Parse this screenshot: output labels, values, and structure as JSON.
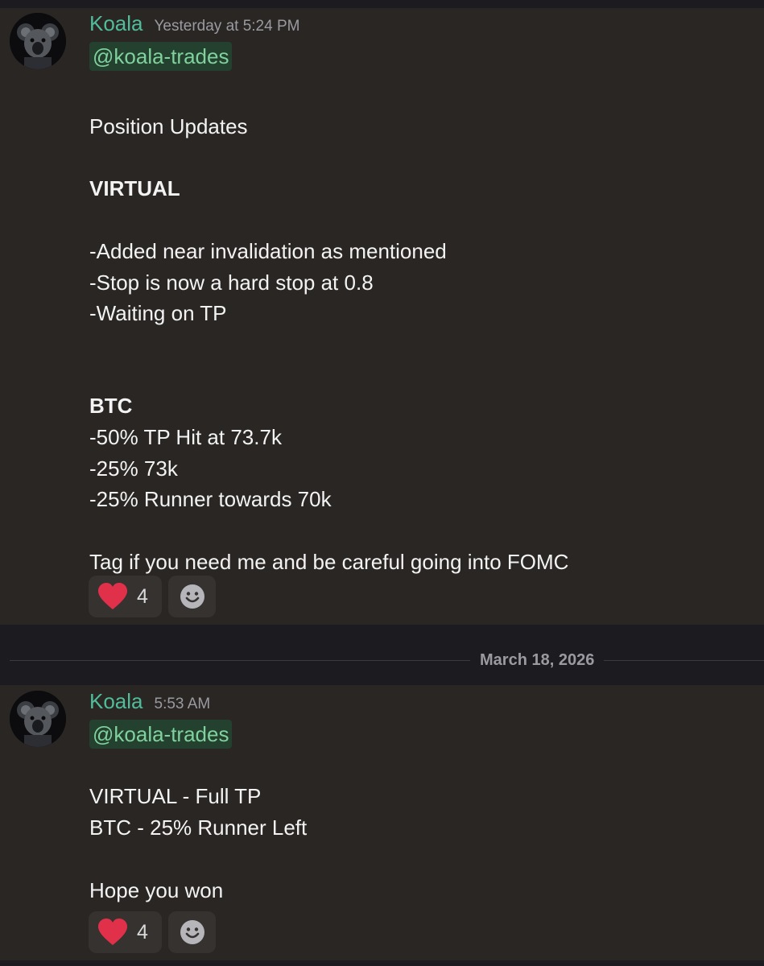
{
  "messages": [
    {
      "author": "Koala",
      "timestamp": "Yesterday at 5:24 PM",
      "mention": "@koala-trades",
      "lines": {
        "heading": "Position Updates",
        "virtual_title": "VIRTUAL",
        "v1": "-Added near invalidation as mentioned",
        "v2": "-Stop is now a hard stop at 0.8",
        "v3": "-Waiting on TP",
        "btc_title": "BTC",
        "b1": "-50% TP Hit at 73.7k",
        "b2": "-25% 73k",
        "b3": "-25% Runner towards 70k",
        "closing": "Tag if you need me and be careful going into FOMC"
      },
      "reaction": {
        "emoji": "heart-icon",
        "count": "4"
      }
    },
    {
      "author": "Koala",
      "timestamp": "5:53 AM",
      "mention": "@koala-trades",
      "lines": {
        "l1": "VIRTUAL - Full TP",
        "l2": "BTC - 25% Runner Left",
        "l3": "Hope you won"
      },
      "reaction": {
        "emoji": "heart-icon",
        "count": "4"
      }
    }
  ],
  "date_divider": "March 18, 2026",
  "colors": {
    "username": "#4fbd9b",
    "mention_text": "#7fd29d",
    "mention_bg": "#24402f",
    "message_bg": "#2a2623",
    "app_bg": "#1c1b1f",
    "heart": "#e0304a"
  }
}
